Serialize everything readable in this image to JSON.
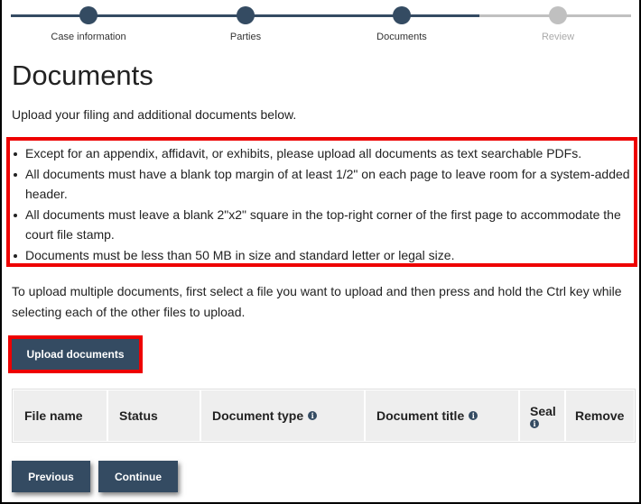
{
  "stepper": {
    "steps": [
      {
        "label": "Case information",
        "state": "complete"
      },
      {
        "label": "Parties",
        "state": "complete"
      },
      {
        "label": "Documents",
        "state": "current"
      },
      {
        "label": "Review",
        "state": "upcoming"
      }
    ]
  },
  "page": {
    "title": "Documents",
    "intro": "Upload your filing and additional documents below."
  },
  "requirements": [
    "Except for an appendix, affidavit, or exhibits, please upload all documents as text searchable PDFs.",
    "All documents must have a blank top margin of at least 1/2\" on each page to leave room for a system-added header.",
    "All documents must leave a blank 2\"x2\" square in the top-right corner of the first page to accommodate the court file stamp.",
    "Documents must be less than 50 MB in size and standard letter or legal size."
  ],
  "hint": "To upload multiple documents, first select a file you want to upload and then press and hold the Ctrl key while selecting each of the other files to upload.",
  "upload_button": "Upload documents",
  "table": {
    "columns": [
      {
        "label": "File name",
        "info": false
      },
      {
        "label": "Status",
        "info": false
      },
      {
        "label": "Document type",
        "info": true
      },
      {
        "label": "Document title",
        "info": true
      },
      {
        "label": "Seal",
        "info": true
      },
      {
        "label": "Remove",
        "info": false
      }
    ],
    "info_glyph": "i"
  },
  "footer": {
    "previous": "Previous",
    "continue": "Continue"
  },
  "colors": {
    "primary": "#344b62",
    "highlight": "#ee0000",
    "inactive": "#c0c0c0"
  }
}
